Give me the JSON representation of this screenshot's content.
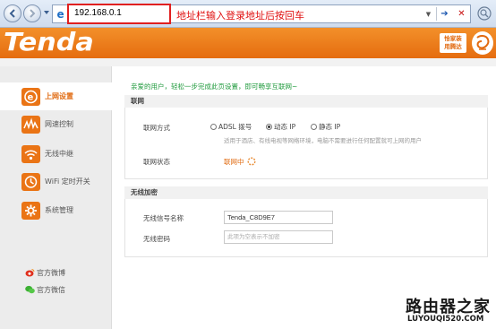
{
  "browser": {
    "url": "192.168.0.1",
    "hint": "地址栏输入登录地址后按回车"
  },
  "header": {
    "logo": "Tenda",
    "badge_line1": "恰家装",
    "badge_line2": "用腾达"
  },
  "sidebar": {
    "items": [
      {
        "label": "上网设置",
        "icon": "globe-e-icon",
        "active": true
      },
      {
        "label": "网速控制",
        "icon": "speed-wave-icon",
        "active": false
      },
      {
        "label": "无线中继",
        "icon": "wifi-relay-icon",
        "active": false
      },
      {
        "label": "WiFi 定时开关",
        "icon": "wifi-timer-icon",
        "active": false
      },
      {
        "label": "系统管理",
        "icon": "gear-icon",
        "active": false
      }
    ],
    "social": [
      {
        "label": "官方微博",
        "icon": "weibo-icon"
      },
      {
        "label": "官方微信",
        "icon": "wechat-icon"
      }
    ]
  },
  "main": {
    "welcome": "亲爱的用户，轻松一步完成此页设置，即可畅享互联网~",
    "internet": {
      "title": "联网",
      "mode_label": "联网方式",
      "modes": [
        {
          "label": "ADSL 拨号",
          "selected": false
        },
        {
          "label": "动态 IP",
          "selected": true
        },
        {
          "label": "静态 IP",
          "selected": false
        }
      ],
      "mode_note": "适用于酒店、有线电视等网络环境，电脑不需要进行任何配置就可上网的用户",
      "status_label": "联网状态",
      "status_value": "联网中"
    },
    "wireless": {
      "title": "无线加密",
      "ssid_label": "无线信号名称",
      "ssid_value": "Tenda_C8D9E7",
      "password_label": "无线密码",
      "password_placeholder": "此项为空表示不加密"
    }
  },
  "watermark": {
    "title": "路由器之家",
    "url": "LUYOUQI520.COM"
  },
  "colors": {
    "brand_orange": "#e8721a",
    "hint_red": "#e01010",
    "welcome_green": "#1f9a3c"
  }
}
